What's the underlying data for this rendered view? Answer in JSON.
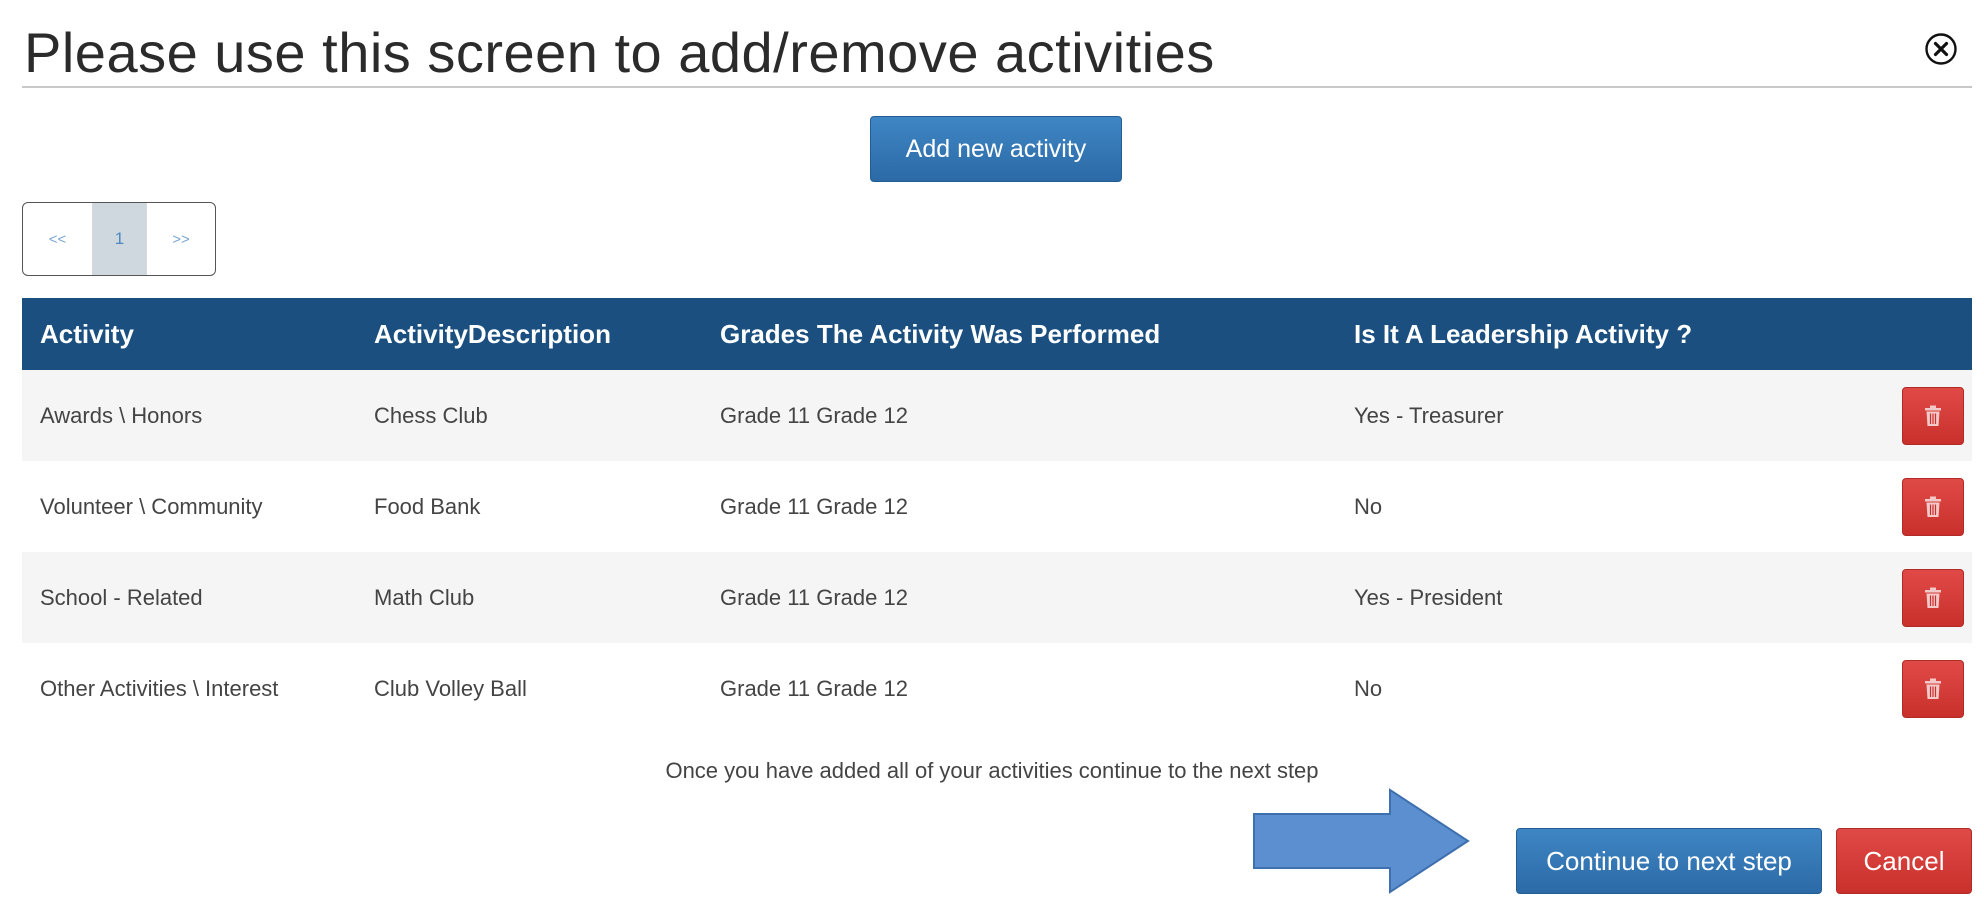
{
  "dialog": {
    "title": "Please use this screen to add/remove activities",
    "close_icon": "close-circle-icon"
  },
  "toolbar": {
    "add_label": "Add new activity"
  },
  "pager": {
    "prev": "<<",
    "current": "1",
    "next": ">>"
  },
  "table": {
    "columns": [
      "Activity",
      "ActivityDescription",
      "Grades The Activity Was Performed",
      "Is It A Leadership Activity ?"
    ],
    "rows": [
      {
        "activity": "Awards \\ Honors",
        "description": "Chess Club",
        "grades": "Grade 11 Grade 12",
        "leadership": "Yes - Treasurer",
        "delete_icon": "trash-icon"
      },
      {
        "activity": "Volunteer \\ Community",
        "description": "Food Bank",
        "grades": "Grade 11 Grade 12",
        "leadership": "No",
        "delete_icon": "trash-icon"
      },
      {
        "activity": "School - Related",
        "description": "Math Club",
        "grades": "Grade 11 Grade 12",
        "leadership": "Yes - President",
        "delete_icon": "trash-icon"
      },
      {
        "activity": "Other Activities \\ Interest",
        "description": "Club Volley Ball",
        "grades": "Grade 11 Grade 12",
        "leadership": "No",
        "delete_icon": "trash-icon"
      }
    ]
  },
  "footer": {
    "note": "Once you have added all of your activities continue to the next step",
    "continue_label": "Continue to next step",
    "cancel_label": "Cancel",
    "pointer_icon": "right-arrow-icon"
  },
  "colors": {
    "header_bg": "#1a4f80",
    "primary": "#337ab7",
    "danger": "#d9534f",
    "arrow_fill": "#5b8fd0"
  }
}
